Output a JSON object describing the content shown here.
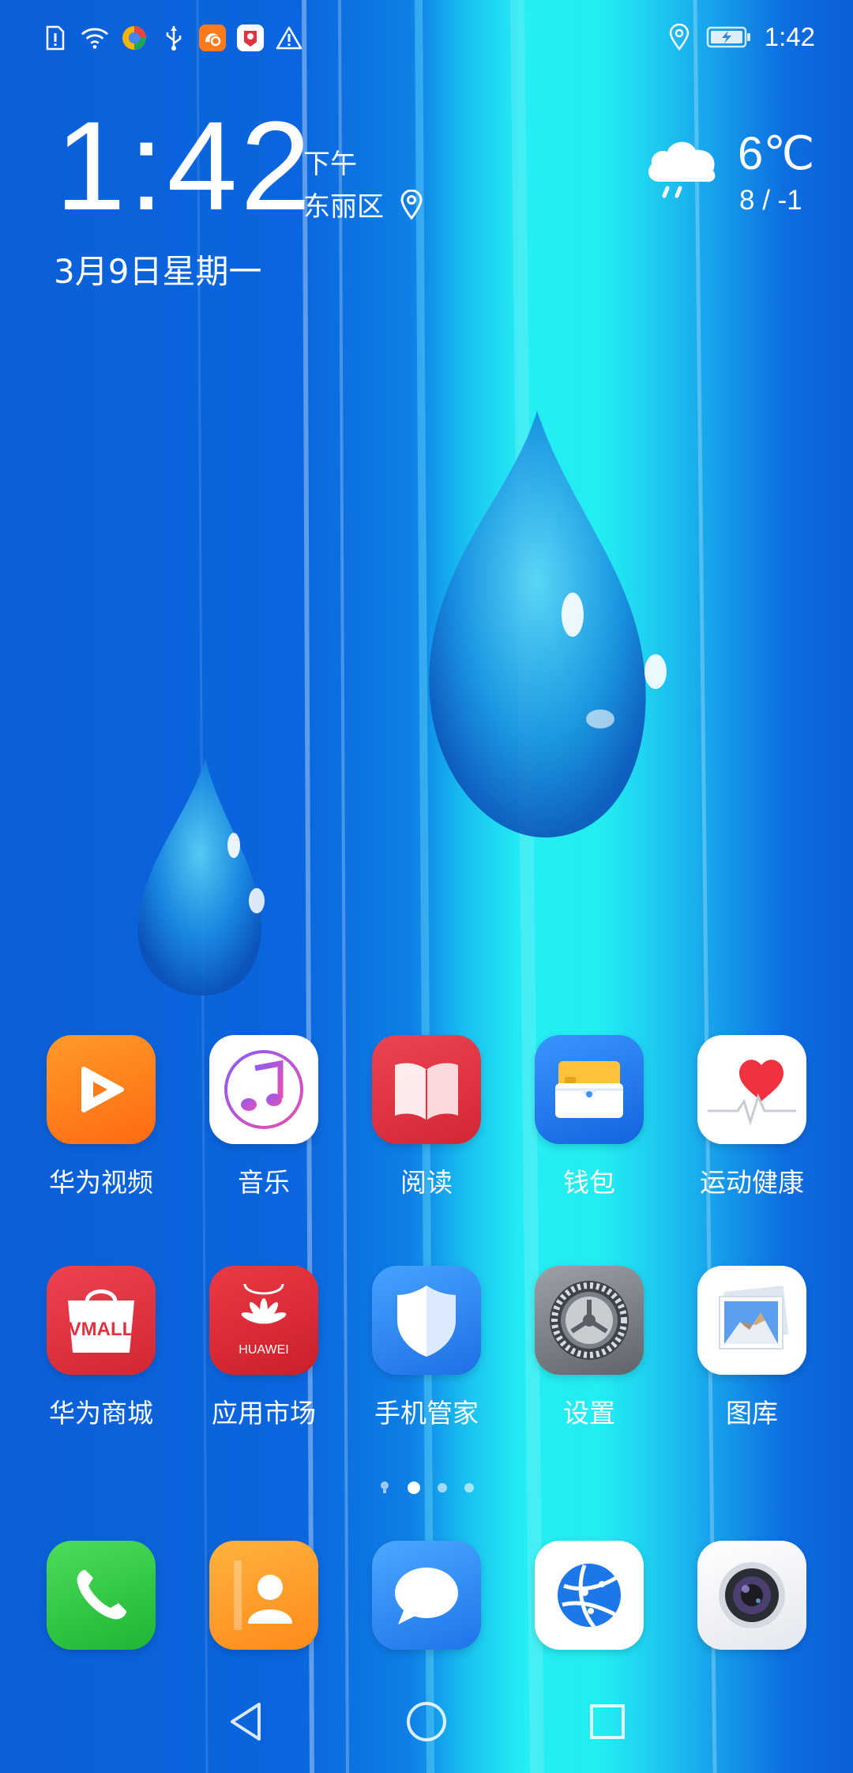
{
  "status_bar": {
    "time": "1:42",
    "left_icons": [
      "sim-alert-icon",
      "wifi-icon",
      "browser-app-icon",
      "usb-icon",
      "uc-browser-icon",
      "notification-app-icon",
      "warning-icon"
    ],
    "right_icons": [
      "location-icon",
      "battery-charging-icon"
    ]
  },
  "clock_widget": {
    "time": "1:42",
    "ampm": "下午",
    "district": "东丽区",
    "date": "3月9日星期一",
    "temperature": "6℃",
    "range": "8 / -1",
    "weather_icon": "rain-cloud-icon"
  },
  "home_apps": [
    {
      "label": "华为视频",
      "icon": "video-icon",
      "color": "#ff7a1a"
    },
    {
      "label": "音乐",
      "icon": "music-icon",
      "color": "#ffffff"
    },
    {
      "label": "阅读",
      "icon": "book-icon",
      "color": "#e0323f"
    },
    {
      "label": "钱包",
      "icon": "wallet-icon",
      "color": "#1f7ef0"
    },
    {
      "label": "运动健康",
      "icon": "health-heart-icon",
      "color": "#ffffff"
    },
    {
      "label": "华为商城",
      "icon": "vmall-bag-icon",
      "color": "#e1303d"
    },
    {
      "label": "应用市场",
      "icon": "app-market-icon",
      "color": "#d9262f"
    },
    {
      "label": "手机管家",
      "icon": "shield-icon",
      "color": "#2f8cf5"
    },
    {
      "label": "设置",
      "icon": "settings-gear-icon",
      "color": "#7d828a"
    },
    {
      "label": "图库",
      "icon": "gallery-icon",
      "color": "#ffffff"
    }
  ],
  "app_badges": {
    "vmall": "VMALL",
    "huawei": "HUAWEI"
  },
  "page_indicator": {
    "pages": 3,
    "current": 1
  },
  "dock_apps": [
    {
      "name": "phone",
      "icon": "phone-icon",
      "color": "#2ecc3f"
    },
    {
      "name": "contacts",
      "icon": "contacts-icon",
      "color": "#ff9a1f"
    },
    {
      "name": "messages",
      "icon": "message-icon",
      "color": "#2f8af4"
    },
    {
      "name": "browser",
      "icon": "browser-globe-icon",
      "color": "#ffffff"
    },
    {
      "name": "camera",
      "icon": "camera-icon",
      "color": "#f2f3f7"
    }
  ],
  "nav_bar": [
    "back-icon",
    "home-icon",
    "recents-icon"
  ]
}
